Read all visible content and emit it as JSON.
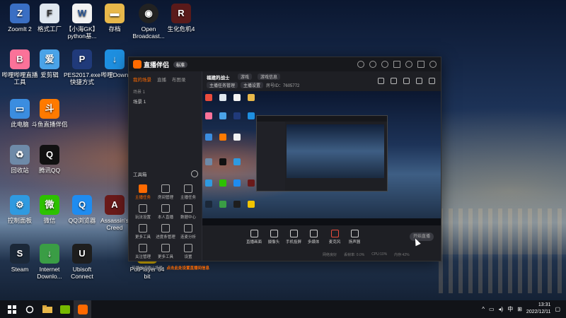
{
  "desktop": {
    "icons": [
      {
        "label": "ZoomIt 2"
      },
      {
        "label": "格式工厂"
      },
      {
        "label": "【小海GK】python基..."
      },
      {
        "label": "存档"
      },
      {
        "label": "Open Broadcast..."
      },
      {
        "label": "生化危机4"
      },
      {
        "label": "哔哩哔哩直播工具"
      },
      {
        "label": "爱剪辑"
      },
      {
        "label": "PES2017.exe 快捷方式"
      },
      {
        "label": "哔哩Down"
      },
      {
        "label": "此电脑"
      },
      {
        "label": "斗鱼直播伴侣"
      },
      {
        "label": "回收站"
      },
      {
        "label": "腾讯QQ"
      },
      {
        "label": "控制面板"
      },
      {
        "label": "微信"
      },
      {
        "label": "QQ浏览器"
      },
      {
        "label": "Assassin's Creed"
      },
      {
        "label": "Steam"
      },
      {
        "label": "Internet Downlo..."
      },
      {
        "label": "Ubisoft Connect"
      },
      {
        "label": "PotPlayer 64 bit"
      }
    ]
  },
  "app": {
    "name": "直播伴侣",
    "badge": "标准",
    "left_tabs": [
      "我的场景",
      "直播",
      "布图录"
    ],
    "scene_header": "场景 1",
    "scene_item": "场景 1",
    "tools_title": "工具箱",
    "tools": [
      "主播任务",
      "房间管理",
      "主播任务",
      "玩法设置",
      "本人直播",
      "数据中心",
      "更多工具",
      "进度条管理",
      "连麦分析",
      "关注管理",
      "更多工具",
      "设置"
    ],
    "notice_text": "开播前请确认场景，",
    "notice_link": "点击此处设置直播间信息",
    "room_title": "福建的战士",
    "room_tag1": "游戏",
    "room_tag2": "游戏信息",
    "sub_chip1": "主播任务管理",
    "sub_chip2": "主播设置",
    "uid": "房号ID：7605772",
    "bottom_tools": [
      "直播画面",
      "摄像头",
      "手机投屏",
      "多媒体",
      "麦克风",
      "扬声器"
    ],
    "start_label": "开始直播",
    "status": [
      "网络良好",
      "丢帧率: 0.0%",
      "CPU:10%",
      "内存:42%"
    ]
  },
  "taskbar": {
    "time": "13:31",
    "date": "2022/12/11",
    "ime": "中"
  }
}
